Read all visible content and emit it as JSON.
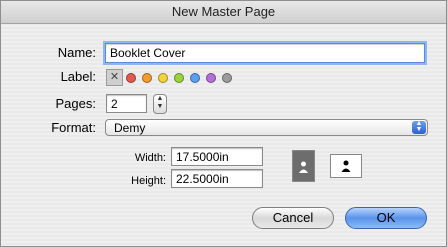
{
  "window": {
    "title": "New Master Page"
  },
  "name": {
    "label": "Name:",
    "value": "Booklet Cover"
  },
  "label_row": {
    "label": "Label:",
    "none_icon": "x-icon",
    "colors": [
      "#e05a52",
      "#f29b2f",
      "#f1d43a",
      "#9ad23b",
      "#5aa0ef",
      "#b46fd6",
      "#9b9b9b"
    ]
  },
  "pages": {
    "label": "Pages:",
    "value": "2"
  },
  "format": {
    "label": "Format:",
    "value": "Demy"
  },
  "width": {
    "label": "Width:",
    "value": "17.5000in"
  },
  "height": {
    "label": "Height:",
    "value": "22.5000in"
  },
  "orientation": {
    "portrait_icon": "portrait-person-icon",
    "landscape_icon": "landscape-person-icon"
  },
  "buttons": {
    "cancel": "Cancel",
    "ok": "OK"
  }
}
